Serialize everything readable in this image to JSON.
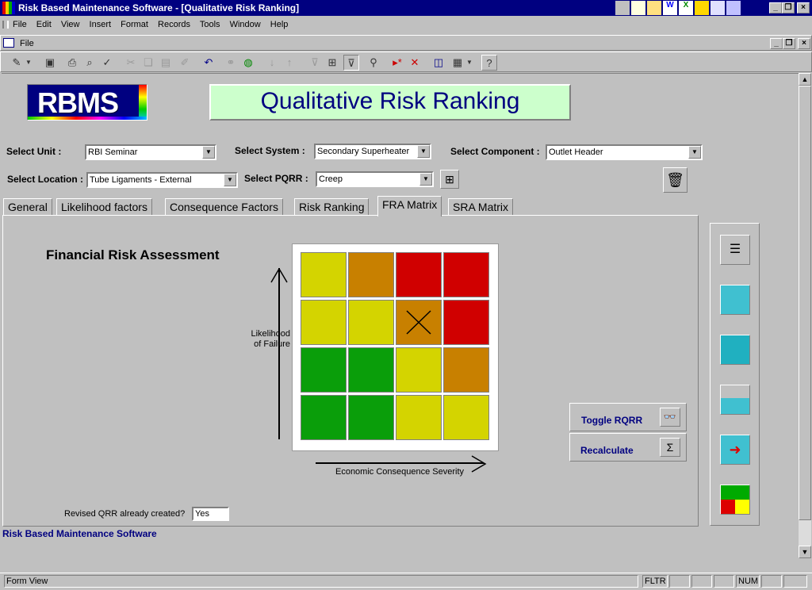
{
  "window": {
    "title": "Risk Based Maintenance Software - [Qualitative Risk Ranking]"
  },
  "menu": [
    "File",
    "Edit",
    "View",
    "Insert",
    "Format",
    "Records",
    "Tools",
    "Window",
    "Help"
  ],
  "mdi": {
    "menu_label": "File"
  },
  "header": {
    "logo_text": "RBMS",
    "title": "Qualitative Risk Ranking"
  },
  "filters": {
    "unit": {
      "label": "Select Unit :",
      "value": "RBI Seminar"
    },
    "system": {
      "label": "Select System :",
      "value": "Secondary Superheater"
    },
    "component": {
      "label": "Select Component :",
      "value": "Outlet Header"
    },
    "location": {
      "label": "Select Location :",
      "value": "Tube Ligaments - External"
    },
    "pqrr": {
      "label": "Select PQRR :",
      "value": "Creep"
    }
  },
  "tabs": [
    {
      "label": "General",
      "active": false
    },
    {
      "label": "Likelihood factors",
      "active": false
    },
    {
      "label": "Consequence Factors",
      "active": false
    },
    {
      "label": "Risk Ranking",
      "active": false
    },
    {
      "label": "FRA Matrix",
      "active": true
    },
    {
      "label": "SRA Matrix",
      "active": false
    }
  ],
  "fra": {
    "title": "Financial Risk Assessment",
    "y_label": "Likelihood\nof Failure",
    "x_label": "Economic Consequence Severity",
    "matrix": [
      [
        "yellow",
        "orange",
        "red",
        "red"
      ],
      [
        "yellow",
        "yellow",
        "orange",
        "red"
      ],
      [
        "green",
        "green",
        "yellow",
        "orange"
      ],
      [
        "green",
        "green",
        "yellow",
        "yellow"
      ]
    ],
    "marked_cell": {
      "row": 2,
      "col": 3
    },
    "colors": {
      "yellow": "#d4d400",
      "orange": "#c88000",
      "red": "#d00000",
      "green": "#0a9e0a"
    }
  },
  "actions": {
    "toggle_label": "Toggle RQRR",
    "recalc_label": "Recalculate"
  },
  "revised": {
    "label": "Revised QRR already created?",
    "value": "Yes"
  },
  "footer_text": "Risk Based Maintenance Software",
  "status": {
    "view": "Form View",
    "fltr": "FLTR",
    "num": "NUM"
  }
}
